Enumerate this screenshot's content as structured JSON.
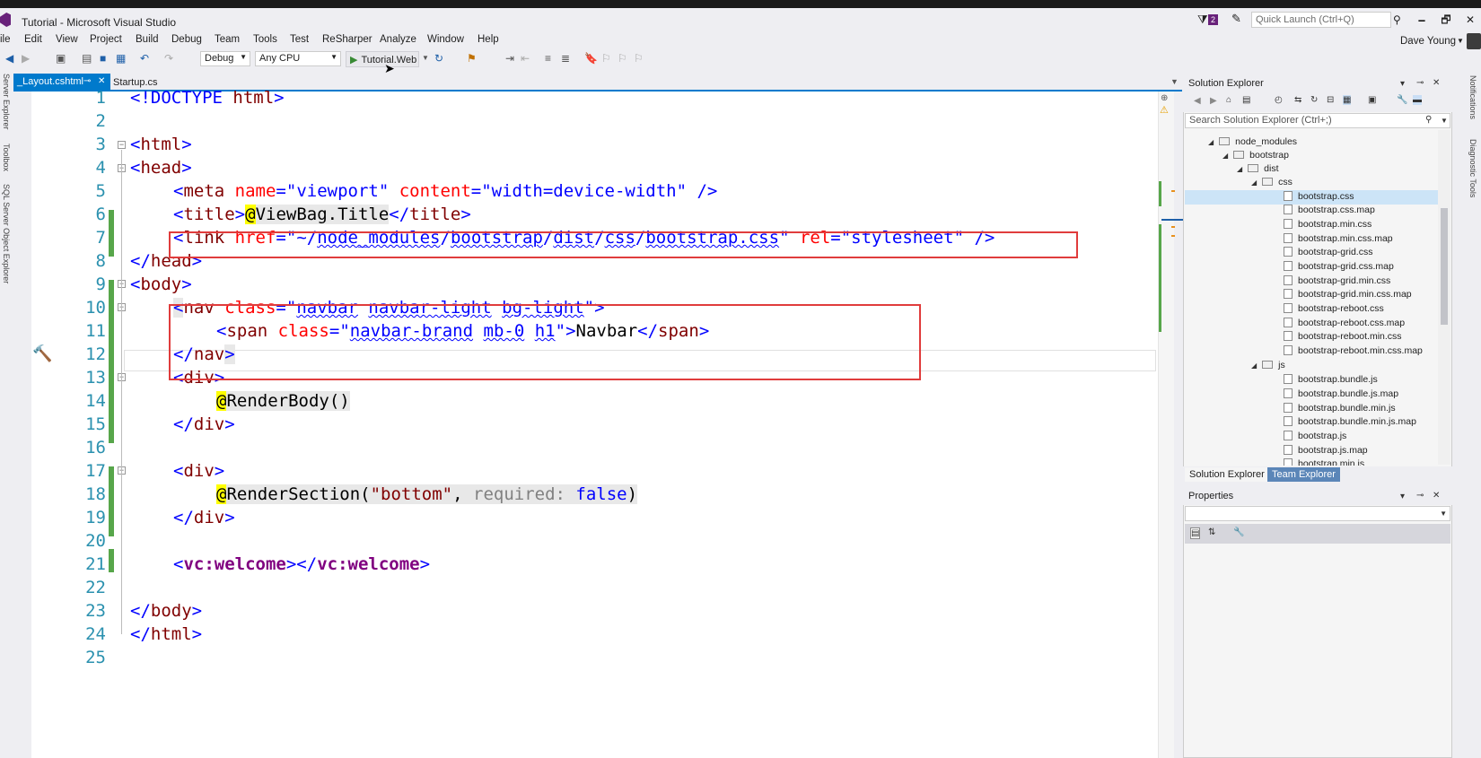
{
  "window": {
    "title": "Tutorial - Microsoft Visual Studio",
    "quick_launch_placeholder": "Quick Launch (Ctrl+Q)",
    "notification_count": "2",
    "minimize_glyph": "🗕",
    "restore_glyph": "🗗",
    "close_glyph": "✕"
  },
  "menu": {
    "items": [
      "ile",
      "Edit",
      "View",
      "Project",
      "Build",
      "Debug",
      "Team",
      "Tools",
      "Test",
      "ReSharper",
      "Analyze",
      "Window",
      "Help"
    ],
    "user": "Dave Young"
  },
  "toolbar": {
    "configuration": "Debug",
    "platform": "Any CPU",
    "run_target": "Tutorial.Web"
  },
  "left_strip": {
    "labels": [
      "Server Explorer",
      "Toolbox",
      "SQL Server Object Explorer"
    ]
  },
  "right_strip": {
    "labels": [
      "Notifications",
      "Diagnostic Tools"
    ]
  },
  "doc_tabs": {
    "active": "_Layout.cshtml",
    "inactive": "Startup.cs"
  },
  "editor": {
    "line_numbers": [
      "1",
      "2",
      "3",
      "4",
      "5",
      "6",
      "7",
      "8",
      "9",
      "10",
      "11",
      "12",
      "13",
      "14",
      "15",
      "16",
      "17",
      "18",
      "19",
      "20",
      "21",
      "22",
      "23",
      "24",
      "25"
    ],
    "tokens": {
      "doctype_open": "<!DOCTYPE ",
      "html_word": "html",
      "gt": ">",
      "lt": "<",
      "lt_slash": "</",
      "self_close": " />",
      "html": "html",
      "head": "head",
      "meta": "meta",
      "name_attr": " name",
      "eq": "=",
      "viewport_val": "\"viewport\"",
      "content_attr": " content",
      "content_val": "\"width=device-width\"",
      "title": "title",
      "at": "@",
      "viewbag_title": "ViewBag.Title",
      "link": "link",
      "href_attr": " href",
      "quote_tilde": "\"~/",
      "path_node_modules": "node_modules",
      "slash": "/",
      "path_bootstrap": "bootstrap",
      "path_dist": "dist",
      "path_css": "css",
      "path_file": "bootstrap.css",
      "quote": "\"",
      "rel_attr": " rel",
      "rel_val": "\"stylesheet\"",
      "body": "body",
      "nav": "nav",
      "class_attr": " class",
      "cls_navbar": "navbar",
      "cls_navbar_light": "navbar-light",
      "cls_bg_light": "bg-light",
      "space": " ",
      "span": "span",
      "cls_navbar_brand": "navbar-brand",
      "cls_mb0": "mb-0",
      "cls_h1": "h1",
      "navbar_text": "Navbar",
      "div": "div",
      "render_body": "RenderBody()",
      "render_section": "RenderSection(",
      "bottom_val": "\"bottom\"",
      "comma": ", ",
      "required_hint": "required: ",
      "false_kw": "false",
      "close_paren": ")",
      "vc_welcome": "vc:welcome"
    }
  },
  "solution_explorer": {
    "title": "Solution Explorer",
    "search_placeholder": "Search Solution Explorer (Ctrl+;)",
    "tree": [
      {
        "label": "node_modules",
        "kind": "folder"
      },
      {
        "label": "bootstrap",
        "kind": "folder"
      },
      {
        "label": "dist",
        "kind": "folder"
      },
      {
        "label": "css",
        "kind": "folder"
      },
      {
        "label": "bootstrap.css",
        "kind": "file",
        "selected": true
      },
      {
        "label": "bootstrap.css.map",
        "kind": "file"
      },
      {
        "label": "bootstrap.min.css",
        "kind": "file"
      },
      {
        "label": "bootstrap.min.css.map",
        "kind": "file"
      },
      {
        "label": "bootstrap-grid.css",
        "kind": "file"
      },
      {
        "label": "bootstrap-grid.css.map",
        "kind": "file"
      },
      {
        "label": "bootstrap-grid.min.css",
        "kind": "file"
      },
      {
        "label": "bootstrap-grid.min.css.map",
        "kind": "file"
      },
      {
        "label": "bootstrap-reboot.css",
        "kind": "file"
      },
      {
        "label": "bootstrap-reboot.css.map",
        "kind": "file"
      },
      {
        "label": "bootstrap-reboot.min.css",
        "kind": "file"
      },
      {
        "label": "bootstrap-reboot.min.css.map",
        "kind": "file"
      },
      {
        "label": "js",
        "kind": "folder"
      },
      {
        "label": "bootstrap.bundle.js",
        "kind": "file"
      },
      {
        "label": "bootstrap.bundle.js.map",
        "kind": "file"
      },
      {
        "label": "bootstrap.bundle.min.js",
        "kind": "file"
      },
      {
        "label": "bootstrap.bundle.min.js.map",
        "kind": "file"
      },
      {
        "label": "bootstrap.js",
        "kind": "file"
      },
      {
        "label": "bootstrap.js.map",
        "kind": "file"
      },
      {
        "label": "bootstrap.min.js",
        "kind": "file"
      }
    ],
    "tabs": [
      "Solution Explorer",
      "Team Explorer"
    ]
  },
  "properties": {
    "title": "Properties"
  },
  "colors": {
    "accent": "#007acc",
    "highlight_box": "#e03c3c",
    "change_marker": "#57a64a",
    "tag": "#800000",
    "attribute": "#ff0000",
    "string": "#0000ff",
    "line_number": "#2b91af"
  }
}
